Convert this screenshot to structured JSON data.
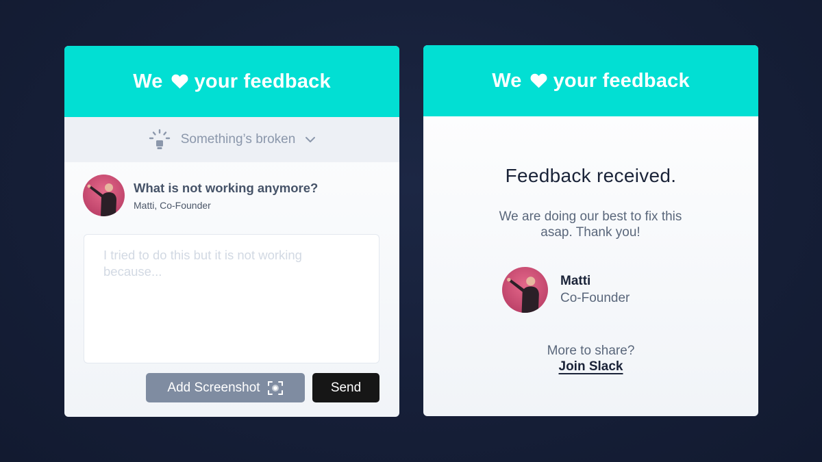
{
  "colors": {
    "header_accent": "#02dfd3",
    "screenshot_button": "#7f8ca1",
    "send_button": "#161616",
    "background": "#161f38"
  },
  "form_card": {
    "header": {
      "prefix": "We",
      "icon": "heart-icon",
      "suffix": "your feedback"
    },
    "category": {
      "icon": "lightbulb-icon",
      "selected": "Something’s broken",
      "dropdown_icon": "chevron-down-icon"
    },
    "author": {
      "question": "What is not working anymore?",
      "byline": "Matti, Co-Founder"
    },
    "feedback_input": {
      "value": "",
      "placeholder": "I tried to do this but it is not working because..."
    },
    "screenshot_button": {
      "label": "Add Screenshot",
      "icon": "screenshot-capture-icon"
    },
    "send_button": {
      "label": "Send"
    }
  },
  "confirmation_card": {
    "header": {
      "prefix": "We",
      "icon": "heart-icon",
      "suffix": "your feedback"
    },
    "title": "Feedback received.",
    "message": "We are doing our best to fix this asap. Thank you!",
    "signoff": {
      "name": "Matti",
      "role": "Co-Founder"
    },
    "more_prompt": "More to share?",
    "slack_link": "Join Slack"
  }
}
